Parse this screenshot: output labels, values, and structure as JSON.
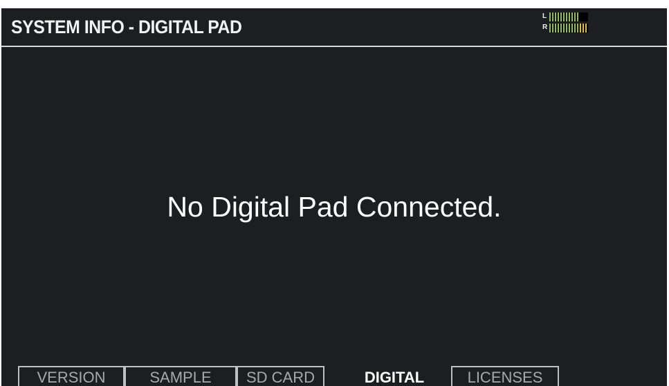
{
  "header": {
    "title": "SYSTEM INFO - DIGITAL PAD",
    "meter": {
      "left_label": "L",
      "right_label": "R",
      "segments": 14,
      "left_level": 0.8,
      "right_level": 1.0
    }
  },
  "main": {
    "message": "No Digital Pad Connected."
  },
  "tabs": [
    {
      "label": "VERSION",
      "active": false
    },
    {
      "label": "SAMPLE",
      "active": false
    },
    {
      "label": "SD CARD",
      "active": false
    },
    {
      "label": "DIGITAL",
      "active": true
    },
    {
      "label": "LICENSES",
      "active": false
    }
  ],
  "colors": {
    "background": "#1c1e21",
    "meter_green": "#8fc24a",
    "meter_yellow": "#e8c21c",
    "meter_off": "#000000"
  }
}
